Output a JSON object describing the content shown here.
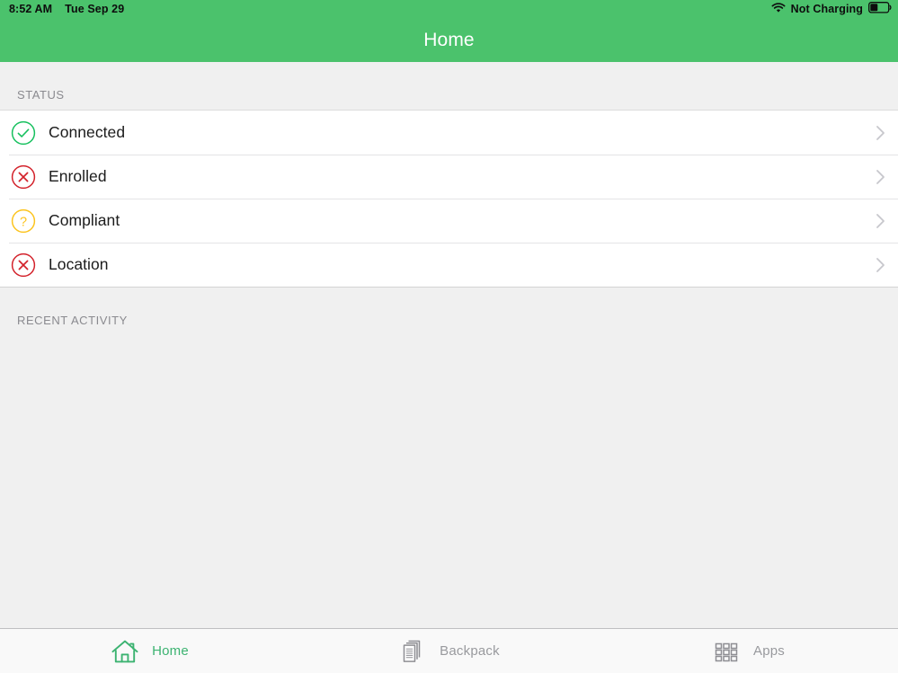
{
  "status_bar": {
    "time": "8:52 AM",
    "date": "Tue Sep 29",
    "wifi_icon": "wifi-icon",
    "charging_label": "Not Charging",
    "battery_icon": "battery-icon",
    "battery_level_percent": 38,
    "background_color": "#4bc26c"
  },
  "nav_bar": {
    "title": "Home",
    "background_color": "#4bc26c",
    "title_color": "#ffffff"
  },
  "sections": {
    "status": {
      "header": "STATUS",
      "rows": [
        {
          "label": "Connected",
          "icon": "check-circle-icon",
          "state": "ok",
          "color": "#16c05e",
          "chevron": "chevron-right-icon"
        },
        {
          "label": "Enrolled",
          "icon": "x-circle-icon",
          "state": "error",
          "color": "#d3222b",
          "chevron": "chevron-right-icon"
        },
        {
          "label": "Compliant",
          "icon": "question-circle-icon",
          "state": "unknown",
          "color": "#fcc41f",
          "chevron": "chevron-right-icon"
        },
        {
          "label": "Location",
          "icon": "x-circle-icon",
          "state": "error",
          "color": "#d3222b",
          "chevron": "chevron-right-icon"
        }
      ]
    },
    "recent_activity": {
      "header": "RECENT ACTIVITY",
      "items": []
    }
  },
  "tab_bar": {
    "tabs": [
      {
        "label": "Home",
        "icon": "home-icon",
        "active": true,
        "color": "#3cb371"
      },
      {
        "label": "Backpack",
        "icon": "documents-icon",
        "active": false,
        "color": "#999a9e"
      },
      {
        "label": "Apps",
        "icon": "grid-icon",
        "active": false,
        "color": "#999a9e"
      }
    ]
  }
}
